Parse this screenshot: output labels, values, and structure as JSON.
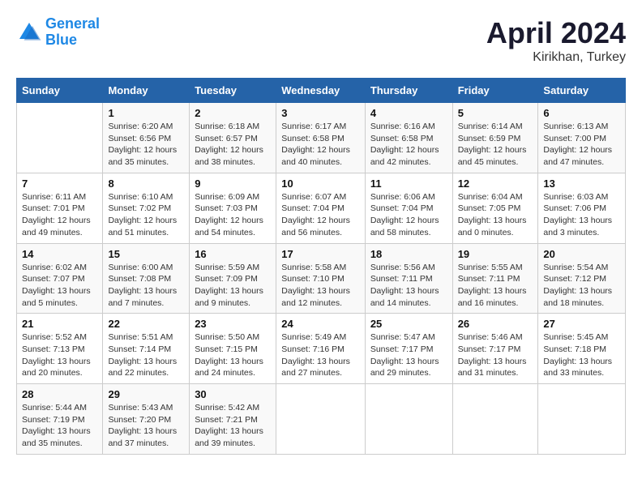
{
  "header": {
    "logo_line1": "General",
    "logo_line2": "Blue",
    "month": "April 2024",
    "location": "Kirikhan, Turkey"
  },
  "days_of_week": [
    "Sunday",
    "Monday",
    "Tuesday",
    "Wednesday",
    "Thursday",
    "Friday",
    "Saturday"
  ],
  "weeks": [
    [
      {
        "num": "",
        "info": ""
      },
      {
        "num": "1",
        "info": "Sunrise: 6:20 AM\nSunset: 6:56 PM\nDaylight: 12 hours\nand 35 minutes."
      },
      {
        "num": "2",
        "info": "Sunrise: 6:18 AM\nSunset: 6:57 PM\nDaylight: 12 hours\nand 38 minutes."
      },
      {
        "num": "3",
        "info": "Sunrise: 6:17 AM\nSunset: 6:58 PM\nDaylight: 12 hours\nand 40 minutes."
      },
      {
        "num": "4",
        "info": "Sunrise: 6:16 AM\nSunset: 6:58 PM\nDaylight: 12 hours\nand 42 minutes."
      },
      {
        "num": "5",
        "info": "Sunrise: 6:14 AM\nSunset: 6:59 PM\nDaylight: 12 hours\nand 45 minutes."
      },
      {
        "num": "6",
        "info": "Sunrise: 6:13 AM\nSunset: 7:00 PM\nDaylight: 12 hours\nand 47 minutes."
      }
    ],
    [
      {
        "num": "7",
        "info": "Sunrise: 6:11 AM\nSunset: 7:01 PM\nDaylight: 12 hours\nand 49 minutes."
      },
      {
        "num": "8",
        "info": "Sunrise: 6:10 AM\nSunset: 7:02 PM\nDaylight: 12 hours\nand 51 minutes."
      },
      {
        "num": "9",
        "info": "Sunrise: 6:09 AM\nSunset: 7:03 PM\nDaylight: 12 hours\nand 54 minutes."
      },
      {
        "num": "10",
        "info": "Sunrise: 6:07 AM\nSunset: 7:04 PM\nDaylight: 12 hours\nand 56 minutes."
      },
      {
        "num": "11",
        "info": "Sunrise: 6:06 AM\nSunset: 7:04 PM\nDaylight: 12 hours\nand 58 minutes."
      },
      {
        "num": "12",
        "info": "Sunrise: 6:04 AM\nSunset: 7:05 PM\nDaylight: 13 hours\nand 0 minutes."
      },
      {
        "num": "13",
        "info": "Sunrise: 6:03 AM\nSunset: 7:06 PM\nDaylight: 13 hours\nand 3 minutes."
      }
    ],
    [
      {
        "num": "14",
        "info": "Sunrise: 6:02 AM\nSunset: 7:07 PM\nDaylight: 13 hours\nand 5 minutes."
      },
      {
        "num": "15",
        "info": "Sunrise: 6:00 AM\nSunset: 7:08 PM\nDaylight: 13 hours\nand 7 minutes."
      },
      {
        "num": "16",
        "info": "Sunrise: 5:59 AM\nSunset: 7:09 PM\nDaylight: 13 hours\nand 9 minutes."
      },
      {
        "num": "17",
        "info": "Sunrise: 5:58 AM\nSunset: 7:10 PM\nDaylight: 13 hours\nand 12 minutes."
      },
      {
        "num": "18",
        "info": "Sunrise: 5:56 AM\nSunset: 7:11 PM\nDaylight: 13 hours\nand 14 minutes."
      },
      {
        "num": "19",
        "info": "Sunrise: 5:55 AM\nSunset: 7:11 PM\nDaylight: 13 hours\nand 16 minutes."
      },
      {
        "num": "20",
        "info": "Sunrise: 5:54 AM\nSunset: 7:12 PM\nDaylight: 13 hours\nand 18 minutes."
      }
    ],
    [
      {
        "num": "21",
        "info": "Sunrise: 5:52 AM\nSunset: 7:13 PM\nDaylight: 13 hours\nand 20 minutes."
      },
      {
        "num": "22",
        "info": "Sunrise: 5:51 AM\nSunset: 7:14 PM\nDaylight: 13 hours\nand 22 minutes."
      },
      {
        "num": "23",
        "info": "Sunrise: 5:50 AM\nSunset: 7:15 PM\nDaylight: 13 hours\nand 24 minutes."
      },
      {
        "num": "24",
        "info": "Sunrise: 5:49 AM\nSunset: 7:16 PM\nDaylight: 13 hours\nand 27 minutes."
      },
      {
        "num": "25",
        "info": "Sunrise: 5:47 AM\nSunset: 7:17 PM\nDaylight: 13 hours\nand 29 minutes."
      },
      {
        "num": "26",
        "info": "Sunrise: 5:46 AM\nSunset: 7:17 PM\nDaylight: 13 hours\nand 31 minutes."
      },
      {
        "num": "27",
        "info": "Sunrise: 5:45 AM\nSunset: 7:18 PM\nDaylight: 13 hours\nand 33 minutes."
      }
    ],
    [
      {
        "num": "28",
        "info": "Sunrise: 5:44 AM\nSunset: 7:19 PM\nDaylight: 13 hours\nand 35 minutes."
      },
      {
        "num": "29",
        "info": "Sunrise: 5:43 AM\nSunset: 7:20 PM\nDaylight: 13 hours\nand 37 minutes."
      },
      {
        "num": "30",
        "info": "Sunrise: 5:42 AM\nSunset: 7:21 PM\nDaylight: 13 hours\nand 39 minutes."
      },
      {
        "num": "",
        "info": ""
      },
      {
        "num": "",
        "info": ""
      },
      {
        "num": "",
        "info": ""
      },
      {
        "num": "",
        "info": ""
      }
    ]
  ]
}
